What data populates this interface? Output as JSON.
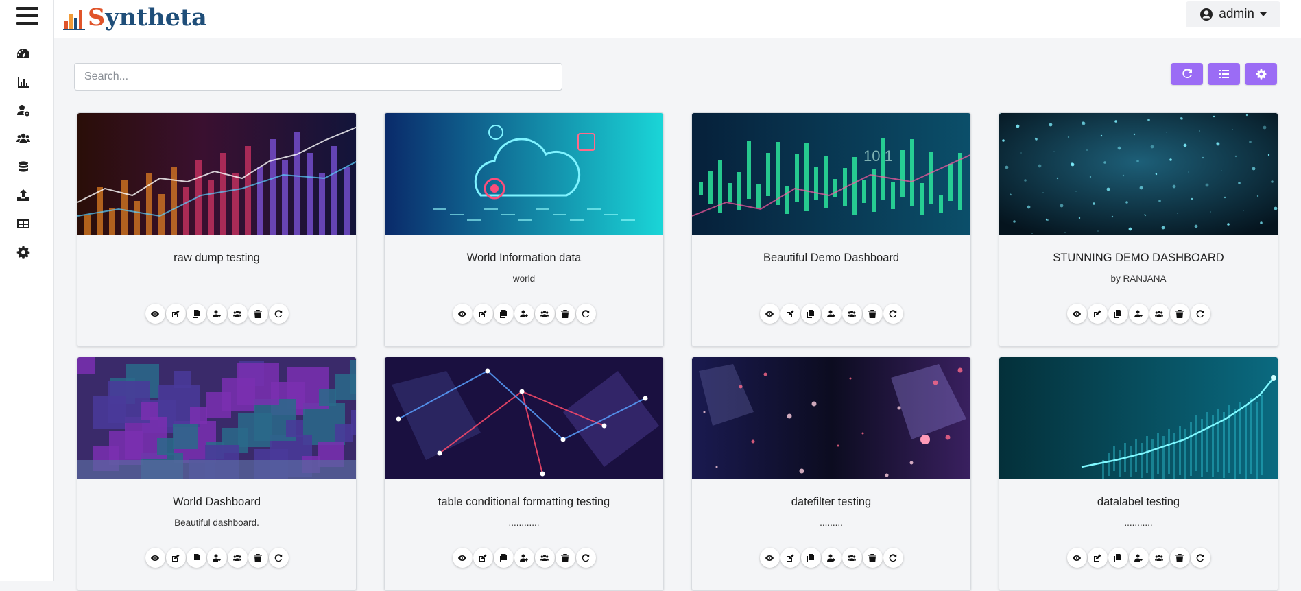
{
  "brand": {
    "name_first": "S",
    "name_rest": "yntheta"
  },
  "user": {
    "name": "admin"
  },
  "search": {
    "placeholder": "Search..."
  },
  "toolbar": {
    "refresh": "refresh-icon",
    "list": "list-icon",
    "settings": "gear-icon"
  },
  "sidebar": {
    "items": [
      {
        "icon": "dashboard-icon"
      },
      {
        "icon": "bar-chart-icon"
      },
      {
        "icon": "user-cog-icon"
      },
      {
        "icon": "users-icon"
      },
      {
        "icon": "database-icon"
      },
      {
        "icon": "upload-icon"
      },
      {
        "icon": "table-icon"
      },
      {
        "icon": "settings-icon"
      }
    ]
  },
  "cards": [
    {
      "title": "raw dump testing",
      "subtitle": ""
    },
    {
      "title": "World Information data",
      "subtitle": "world"
    },
    {
      "title": "Beautiful Demo Dashboard",
      "subtitle": ""
    },
    {
      "title": "STUNNING DEMO DASHBOARD",
      "subtitle": "by RANJANA"
    },
    {
      "title": "World Dashboard",
      "subtitle": "Beautiful dashboard."
    },
    {
      "title": "table conditional formatting testing",
      "subtitle": "............"
    },
    {
      "title": "datefilter testing",
      "subtitle": "........."
    },
    {
      "title": "datalabel testing",
      "subtitle": "..........."
    }
  ],
  "card_actions": [
    "view-icon",
    "edit-icon",
    "copy-icon",
    "share-user-icon",
    "share-group-icon",
    "delete-icon",
    "refresh-icon"
  ],
  "colors": {
    "accent": "#9b6cf5",
    "logo_orange": "#e0542a",
    "logo_blue": "#1f4e79"
  }
}
